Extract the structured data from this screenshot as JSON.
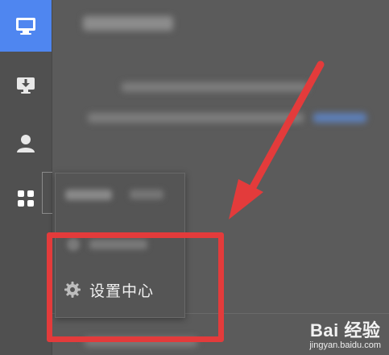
{
  "sidebar": {
    "items": [
      {
        "name": "desktop-icon",
        "active": true
      },
      {
        "name": "monitor-download-icon",
        "active": false
      },
      {
        "name": "user-icon",
        "active": false
      },
      {
        "name": "apps-grid-icon",
        "active": false
      }
    ]
  },
  "popup": {
    "settings_label": "设置中心",
    "settings_icon": "gear-icon"
  },
  "annotation": {
    "color": "#e33b3b"
  },
  "watermark": {
    "brand": "Bai 经验",
    "url": "jingyan.baidu.com"
  },
  "colors": {
    "accent": "#4f86f0",
    "background": "#5b5b5b",
    "sidebar": "#505050"
  }
}
